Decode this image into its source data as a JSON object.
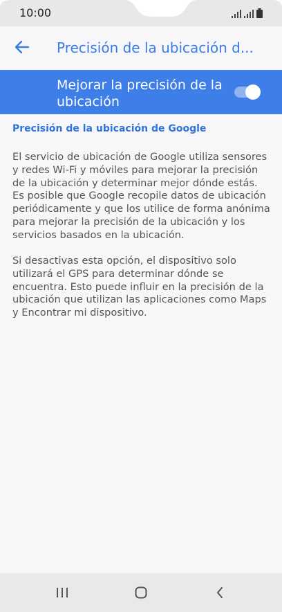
{
  "status_bar": {
    "time": "10:00",
    "icons": [
      "signal-icon",
      "signal-icon-2",
      "battery-icon"
    ]
  },
  "app_bar": {
    "back_icon": "arrow-left-icon",
    "title": "Precisión de la ubicación d..."
  },
  "toggle": {
    "label": "Mejorar la precisión de la ubicación",
    "state": "on",
    "accent": "#3d7ee8"
  },
  "content": {
    "heading": "Precisión de la ubicación de Google",
    "paragraph1": "El servicio de ubicación de Google utiliza sensores y redes Wi-Fi y móviles para mejorar la precisión de la ubicación y determinar mejor dónde estás. Es posible que Google recopile datos de ubicación periódicamente y que los utilice de forma anónima para mejorar la precisión de la ubicación y los servicios basados en la ubicación.",
    "paragraph2": "Si desactivas esta opción, el dispositivo solo utilizará el GPS para determinar dónde se encuentra. Esto puede influir en la precisión de la ubicación que utilizan las aplicaciones como Maps y Encontrar mi dispositivo."
  },
  "nav_bar": {
    "recents_icon": "recents-icon",
    "home_icon": "home-icon",
    "back_icon": "back-chevron-icon"
  },
  "colors": {
    "title": "#3a7be6",
    "toggle_bg": "#3d7ee8",
    "heading": "#2f73dd"
  }
}
